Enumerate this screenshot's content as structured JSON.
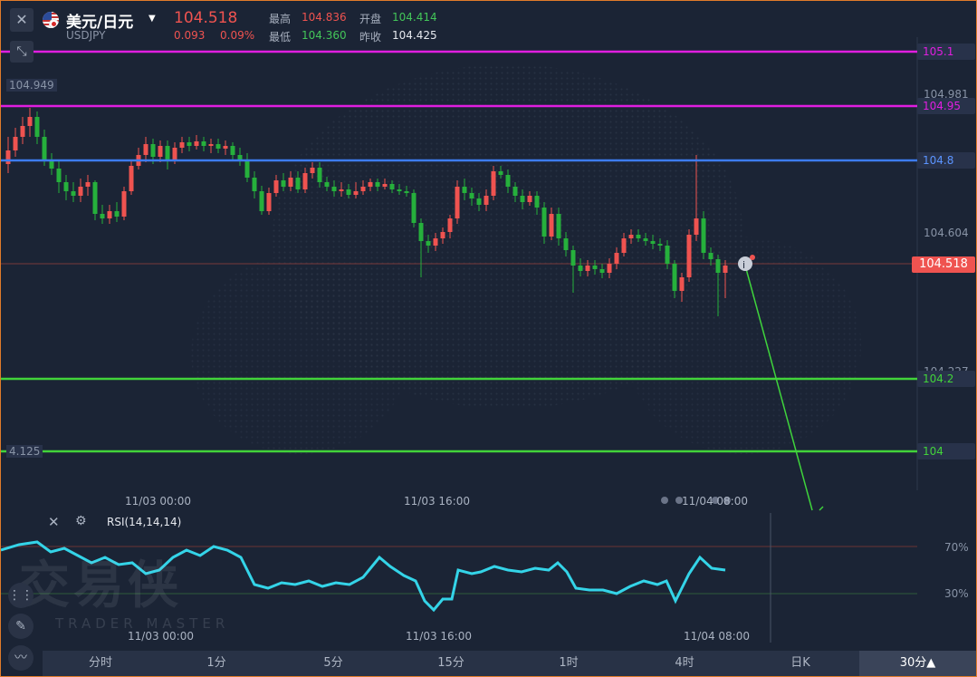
{
  "header": {
    "title": "美元/日元",
    "symbol": "USDJPY",
    "price": "104.518",
    "change": "0.093",
    "change_pct": "0.09%",
    "high_label": "最高",
    "high": "104.836",
    "low_label": "最低",
    "low": "104.360",
    "open_label": "开盘",
    "open": "104.414",
    "prev_label": "昨收",
    "prev_close": "104.425"
  },
  "levels": [
    {
      "label": "105.1",
      "color": "#e01ee0"
    },
    {
      "label": "104.95",
      "color": "#e01ee0"
    },
    {
      "label": "104.8",
      "color": "#3d7cf0"
    },
    {
      "label": "104.2",
      "color": "#42d33a"
    },
    {
      "label": "104",
      "color": "#42d33a"
    }
  ],
  "scale": {
    "top_left": "104.949",
    "r1": "104.981",
    "r2": "104.604",
    "r3": "104.227",
    "bottom_left": "4.125",
    "current": "104.518"
  },
  "time_axis": [
    "11/03 00:00",
    "11/03 16:00",
    "11/04 08:00"
  ],
  "rsi": {
    "label": "RSI(14,14,14)",
    "level_high": "70%",
    "level_low": "30%"
  },
  "watermark": {
    "main": "交易侠",
    "sub": "TRADER MASTER"
  },
  "tabs": [
    {
      "label": "分时"
    },
    {
      "label": "1分"
    },
    {
      "label": "5分"
    },
    {
      "label": "15分"
    },
    {
      "label": "1时"
    },
    {
      "label": "4时"
    },
    {
      "label": "日K"
    },
    {
      "label": "30分▲"
    }
  ],
  "colors": {
    "up": "#ef5350",
    "down": "#26b03c",
    "rsi": "#34d4e8"
  }
}
